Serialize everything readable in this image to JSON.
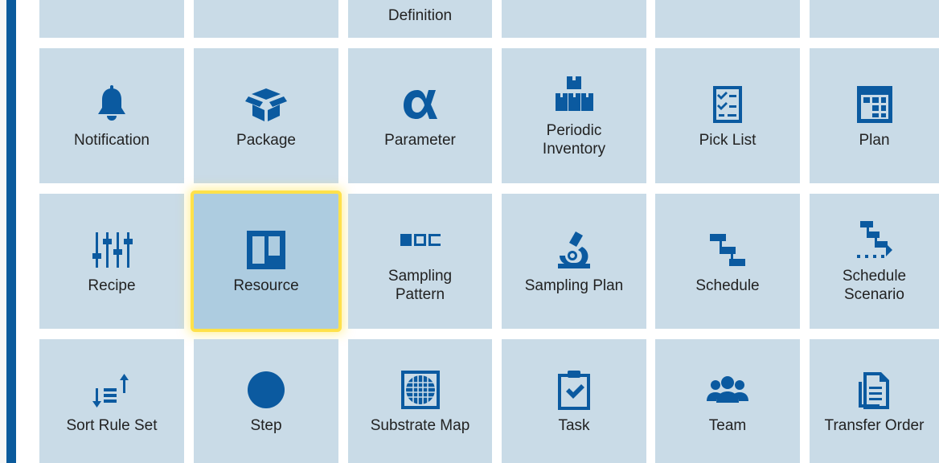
{
  "rows": [
    {
      "partial": true,
      "tiles": [
        {
          "label": "",
          "icon": "none"
        },
        {
          "label": "",
          "icon": "none"
        },
        {
          "label": "Definition",
          "icon": "none"
        },
        {
          "label": "",
          "icon": "none"
        },
        {
          "label": "",
          "icon": "none"
        },
        {
          "label": "",
          "icon": "none"
        }
      ]
    },
    {
      "tiles": [
        {
          "label": "Notification",
          "icon": "bell-icon"
        },
        {
          "label": "Package",
          "icon": "package-icon"
        },
        {
          "label": "Parameter",
          "icon": "alpha-icon"
        },
        {
          "label": "Periodic\nInventory",
          "icon": "boxes-icon"
        },
        {
          "label": "Pick List",
          "icon": "checklist-icon"
        },
        {
          "label": "Plan",
          "icon": "plan-grid-icon"
        }
      ]
    },
    {
      "tiles": [
        {
          "label": "Recipe",
          "icon": "sliders-icon"
        },
        {
          "label": "Resource",
          "icon": "resource-icon",
          "selected": true
        },
        {
          "label": "Sampling\nPattern",
          "icon": "pattern-icon"
        },
        {
          "label": "Sampling Plan",
          "icon": "microscope-icon"
        },
        {
          "label": "Schedule",
          "icon": "schedule-icon"
        },
        {
          "label": "Schedule\nScenario",
          "icon": "schedule-scenario-icon"
        }
      ]
    },
    {
      "tiles": [
        {
          "label": "Sort Rule Set",
          "icon": "sort-icon"
        },
        {
          "label": "Step",
          "icon": "circle-icon"
        },
        {
          "label": "Substrate Map",
          "icon": "wafer-map-icon"
        },
        {
          "label": "Task",
          "icon": "clipboard-check-icon"
        },
        {
          "label": "Team",
          "icon": "team-icon"
        },
        {
          "label": "Transfer Order",
          "icon": "document-icon"
        }
      ]
    }
  ],
  "colors": {
    "accent": "#0a5a9c",
    "tile": "#c9dbe7",
    "tile_selected": "#adcce0",
    "highlight": "#ffe14a",
    "icon": "#0b5aa0"
  }
}
